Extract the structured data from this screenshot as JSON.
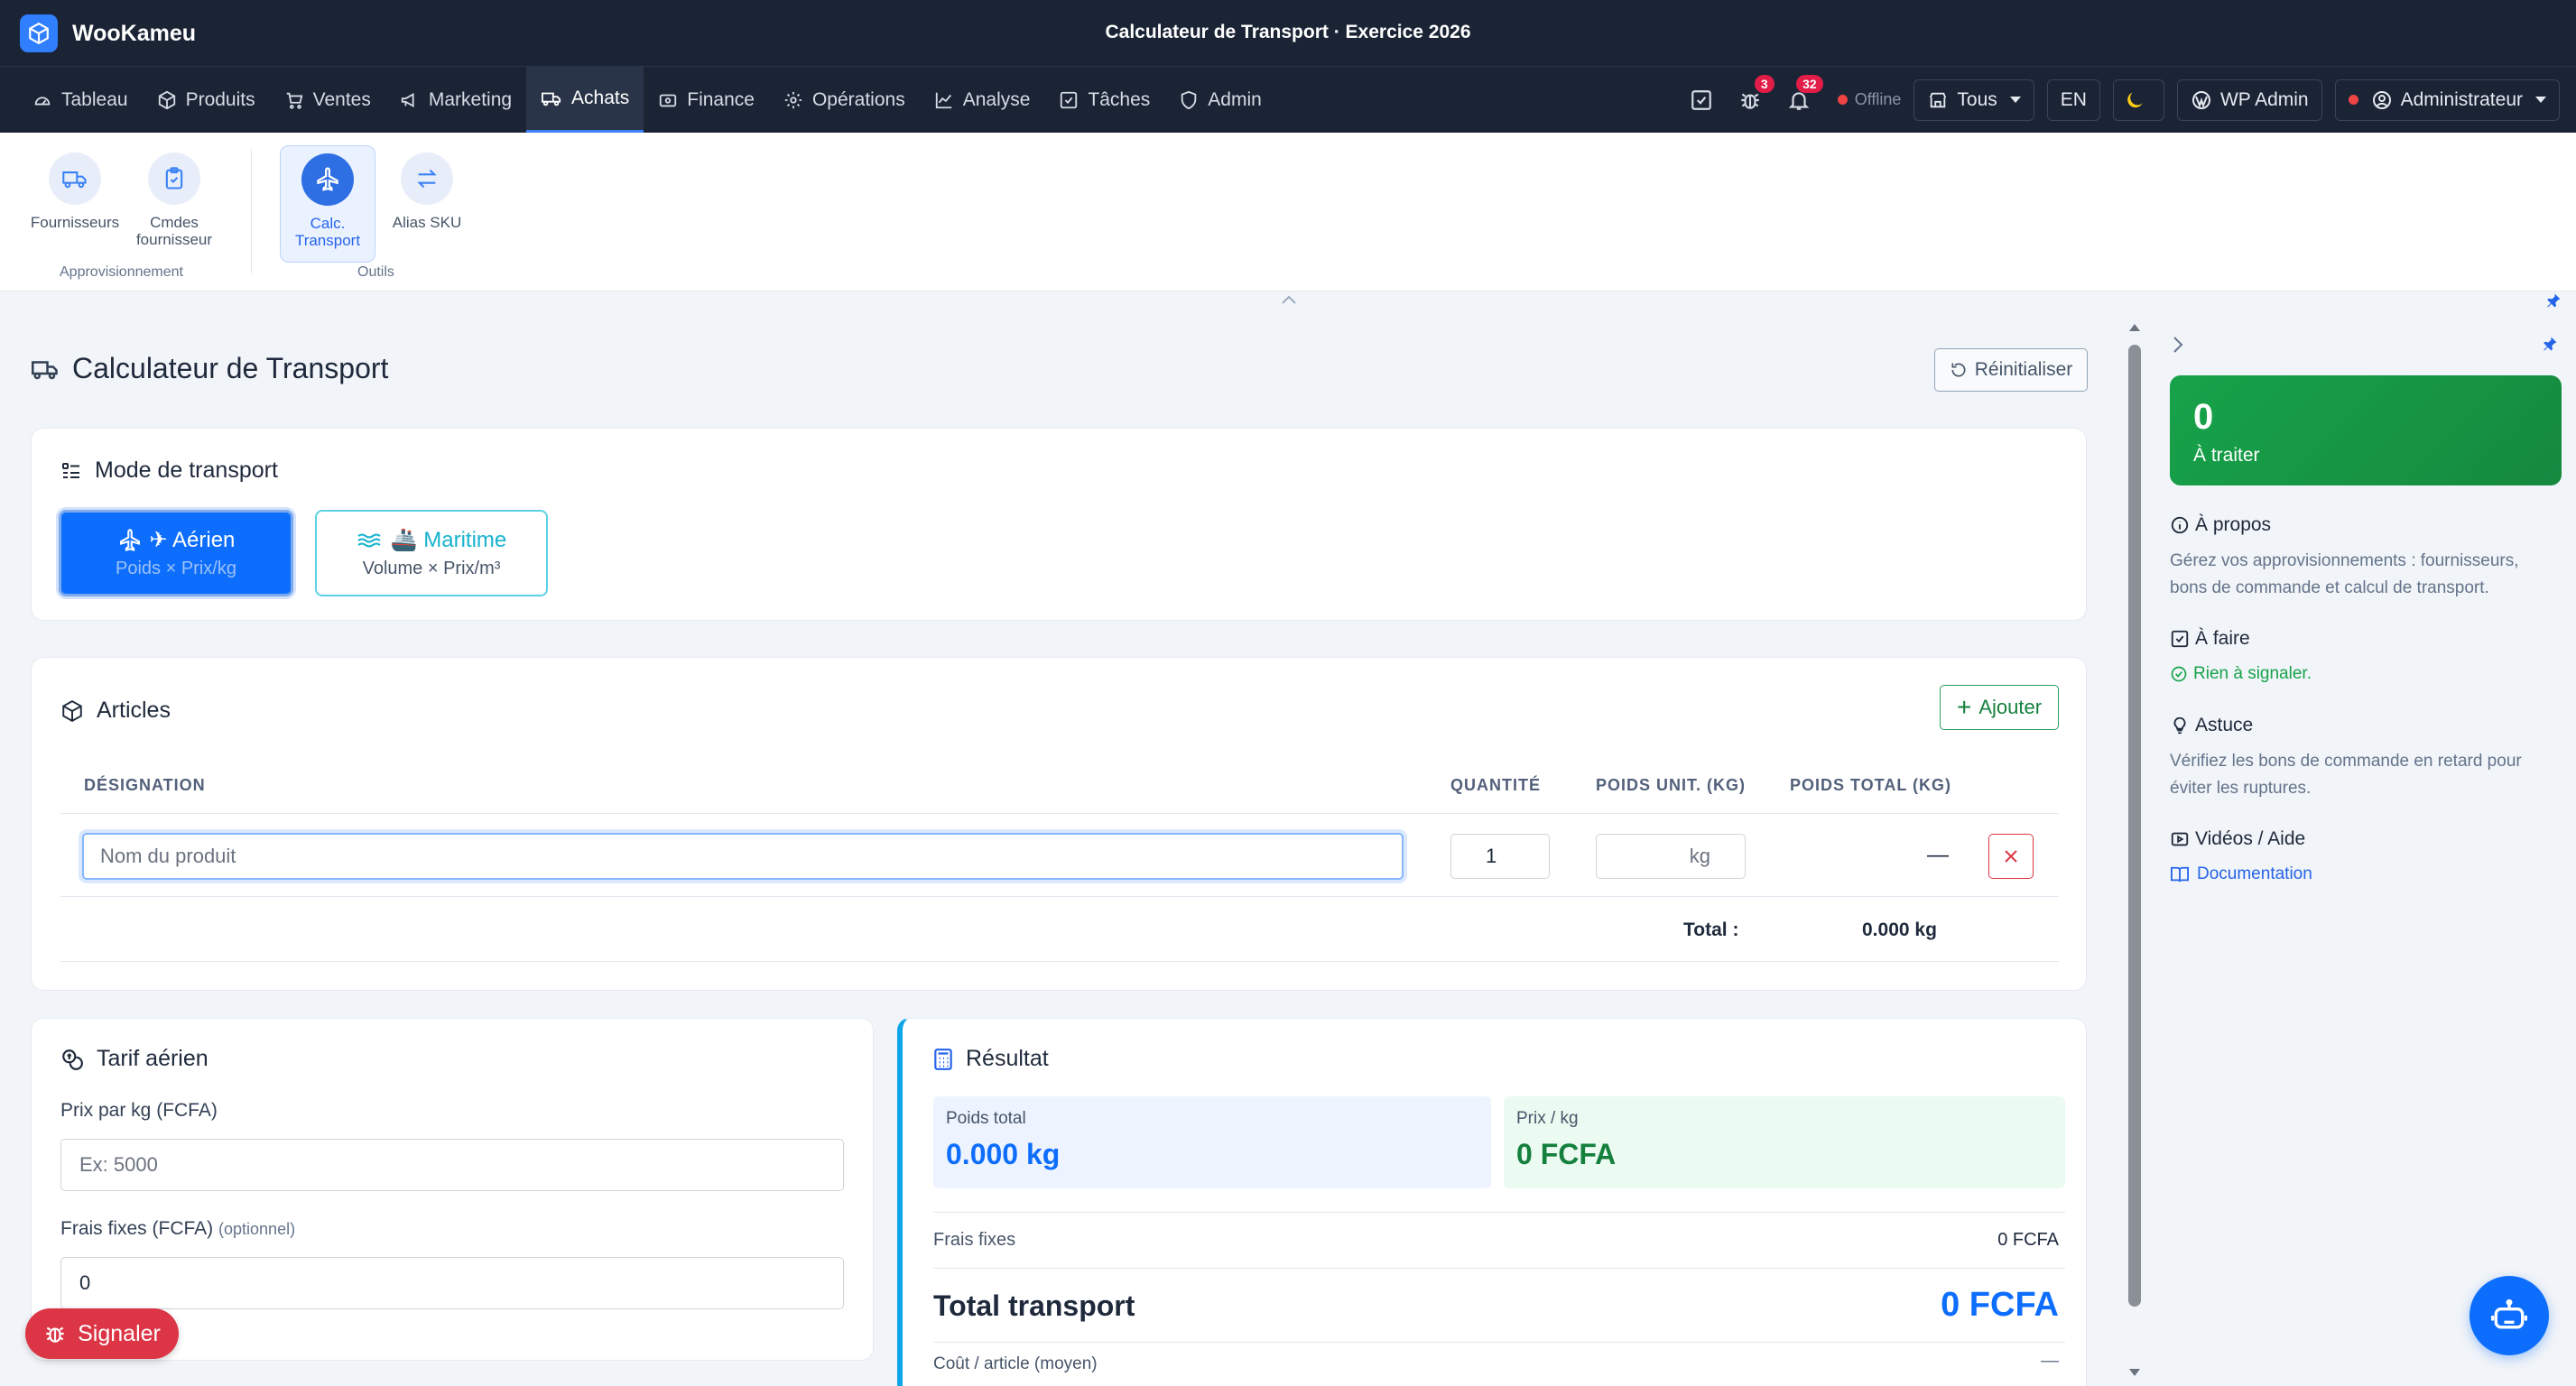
{
  "app": {
    "brand": "WooKameu",
    "title": "Calculateur de Transport · Exercice 2026"
  },
  "nav": {
    "items": [
      {
        "label": "Tableau",
        "icon": "gauge-icon"
      },
      {
        "label": "Produits",
        "icon": "box-icon"
      },
      {
        "label": "Ventes",
        "icon": "cart-icon"
      },
      {
        "label": "Marketing",
        "icon": "megaphone-icon"
      },
      {
        "label": "Achats",
        "icon": "truck-icon",
        "active": true
      },
      {
        "label": "Finance",
        "icon": "wallet-icon"
      },
      {
        "label": "Opérations",
        "icon": "gear-icon"
      },
      {
        "label": "Analyse",
        "icon": "chart-icon"
      },
      {
        "label": "Tâches",
        "icon": "checkbox-icon"
      },
      {
        "label": "Admin",
        "icon": "shield-icon"
      }
    ],
    "bug_badge": "3",
    "notif_badge": "32",
    "offline": "Offline",
    "store_filter": "Tous",
    "lang": "EN",
    "wp_admin": "WP Admin",
    "user": "Administrateur"
  },
  "subnav": {
    "groups": [
      {
        "label": "Approvisionnement",
        "items": [
          {
            "label": "Fournisseurs"
          },
          {
            "label": "Cmdes fournisseur"
          }
        ]
      },
      {
        "label": "Outils",
        "items": [
          {
            "label": "Calc. Transport",
            "active": true
          },
          {
            "label": "Alias SKU"
          }
        ]
      }
    ]
  },
  "page": {
    "title": "Calculateur de Transport",
    "reset": "Réinitialiser"
  },
  "mode": {
    "title": "Mode de transport",
    "air": {
      "label": "✈ Aérien",
      "formula": "Poids × Prix/kg"
    },
    "sea": {
      "label": "🚢 Maritime",
      "formula": "Volume × Prix/m³"
    }
  },
  "articles": {
    "title": "Articles",
    "add": "Ajouter",
    "columns": [
      "DÉSIGNATION",
      "QUANTITÉ",
      "POIDS UNIT. (KG)",
      "POIDS TOTAL (KG)"
    ],
    "row": {
      "name_placeholder": "Nom du produit",
      "qty": "1",
      "unit_suffix": "kg",
      "total": "—"
    },
    "total_label": "Total :",
    "total_value": "0.000 kg"
  },
  "tarif": {
    "title": "Tarif aérien",
    "price_label": "Prix par kg (FCFA)",
    "price_placeholder": "Ex: 5000",
    "fees_label": "Frais fixes (FCFA)",
    "fees_optional": "(optionnel)",
    "fees_value": "0"
  },
  "result": {
    "title": "Résultat",
    "weight_label": "Poids total",
    "weight_value": "0.000 kg",
    "price_label": "Prix / kg",
    "price_value": "0 FCFA",
    "fees_label": "Frais fixes",
    "fees_value": "0 FCFA",
    "total_label": "Total transport",
    "total_value": "0 FCFA",
    "per_article_label": "Coût / article (moyen)",
    "per_article_value": "—"
  },
  "panel": {
    "todo_count": "0",
    "todo_label": "À traiter",
    "about_title": "À propos",
    "about_text": "Gérez vos approvisionnements : fournisseurs, bons de commande et calcul de transport.",
    "tasks_title": "À faire",
    "tasks_ok": "Rien à signaler.",
    "tip_title": "Astuce",
    "tip_text": "Vérifiez les bons de commande en retard pour éviter les ruptures.",
    "videos_title": "Vidéos / Aide",
    "doc_link": "Documentation"
  },
  "floating": {
    "report": "Signaler"
  },
  "colors": {
    "navbar": "#1b2435",
    "primary": "#0d6efd",
    "success": "#16a34a",
    "danger": "#dc3545",
    "sea": "#17b3cf"
  }
}
